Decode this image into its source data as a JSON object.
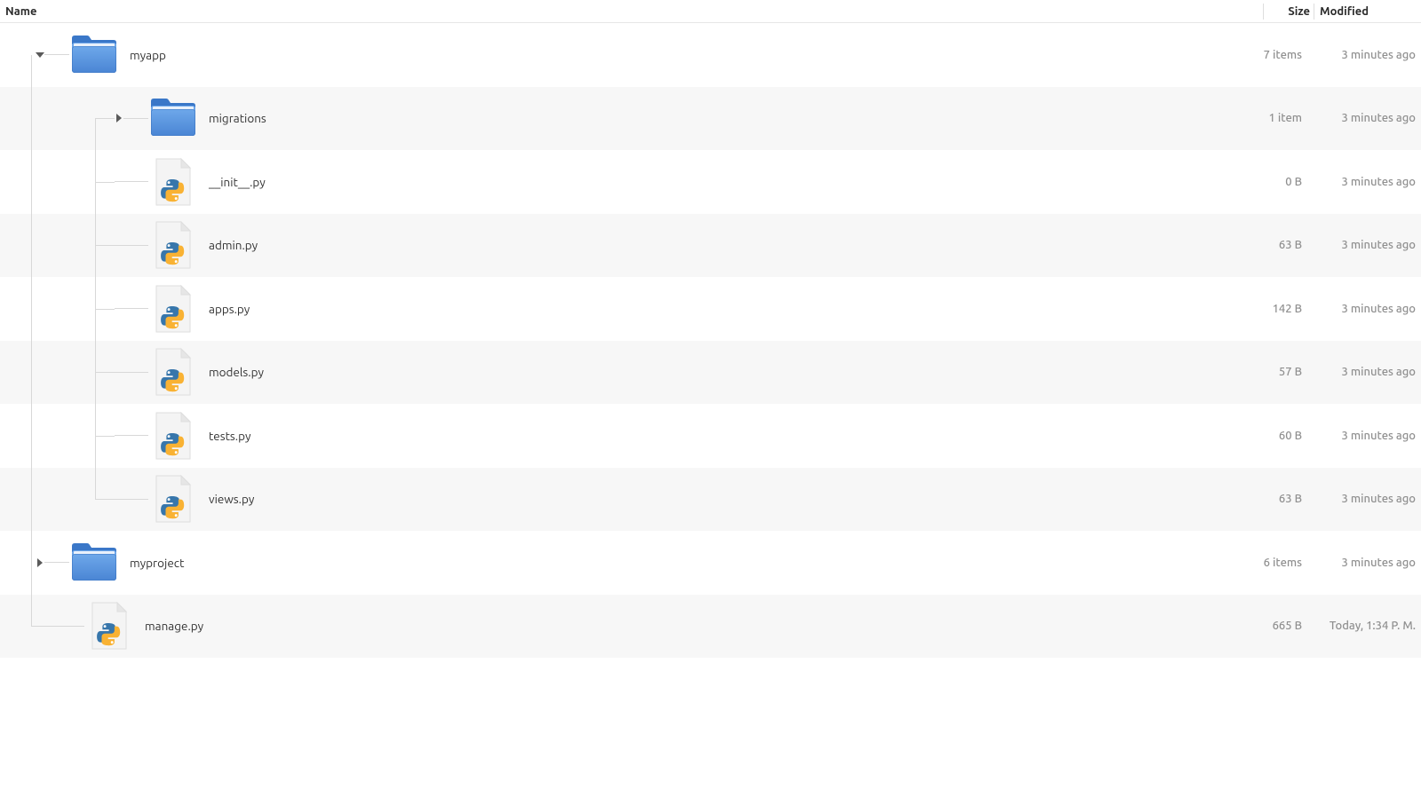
{
  "columns": {
    "name": "Name",
    "size": "Size",
    "modified": "Modified"
  },
  "rows": [
    {
      "name": "myapp",
      "size": "7 items",
      "modified": "3 minutes ago",
      "type": "folder",
      "indent": 0,
      "expander": "down",
      "last": false
    },
    {
      "name": "migrations",
      "size": "1 item",
      "modified": "3 minutes ago",
      "type": "folder",
      "indent": 1,
      "expander": "right",
      "last": false
    },
    {
      "name": "__init__.py",
      "size": "0 B",
      "modified": "3 minutes ago",
      "type": "python",
      "indent": 1,
      "expander": "none",
      "last": false
    },
    {
      "name": "admin.py",
      "size": "63 B",
      "modified": "3 minutes ago",
      "type": "python",
      "indent": 1,
      "expander": "none",
      "last": false
    },
    {
      "name": "apps.py",
      "size": "142 B",
      "modified": "3 minutes ago",
      "type": "python",
      "indent": 1,
      "expander": "none",
      "last": false
    },
    {
      "name": "models.py",
      "size": "57 B",
      "modified": "3 minutes ago",
      "type": "python",
      "indent": 1,
      "expander": "none",
      "last": false
    },
    {
      "name": "tests.py",
      "size": "60 B",
      "modified": "3 minutes ago",
      "type": "python",
      "indent": 1,
      "expander": "none",
      "last": false
    },
    {
      "name": "views.py",
      "size": "63 B",
      "modified": "3 minutes ago",
      "type": "python",
      "indent": 1,
      "expander": "none",
      "last": true
    },
    {
      "name": "myproject",
      "size": "6 items",
      "modified": "3 minutes ago",
      "type": "folder",
      "indent": 0,
      "expander": "right",
      "last": false
    },
    {
      "name": "manage.py",
      "size": "665 B",
      "modified": "Today, 1:34 P. M.",
      "type": "python",
      "indent": 0,
      "expander": "none",
      "last": true
    }
  ]
}
